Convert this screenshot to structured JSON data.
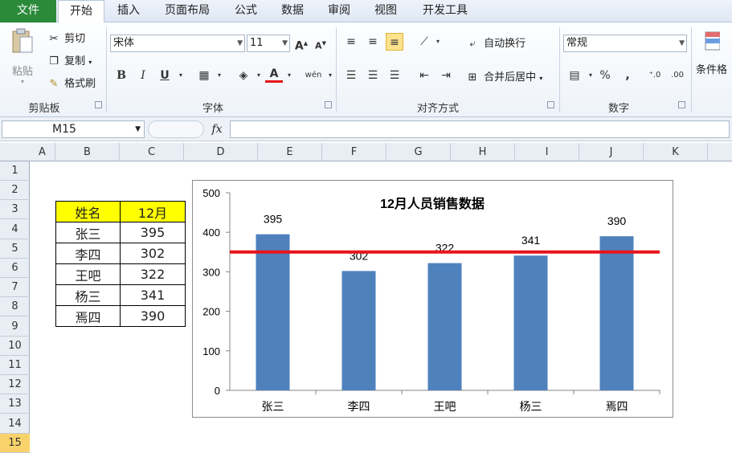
{
  "tabs": {
    "file": "文件",
    "home": "开始",
    "insert": "插入",
    "page_layout": "页面布局",
    "formulas": "公式",
    "data": "数据",
    "review": "审阅",
    "view": "视图",
    "developer": "开发工具"
  },
  "clipboard": {
    "paste": "粘贴",
    "cut": "剪切",
    "copy": "复制",
    "format_painter": "格式刷",
    "label": "剪贴板"
  },
  "font": {
    "name": "宋体",
    "size": "11",
    "label": "字体",
    "grow": "A",
    "shrink": "A",
    "bold": "B",
    "italic": "I",
    "underline": "U",
    "phonetic": "wén"
  },
  "alignment": {
    "wrap_text": "自动换行",
    "merge_center": "合并后居中",
    "label": "对齐方式"
  },
  "number": {
    "format": "常规",
    "label": "数字",
    "percent": "%",
    "comma": ","
  },
  "styles": {
    "conditional": "条件格"
  },
  "formula_bar": {
    "name_box": "M15",
    "fx": "fx",
    "content": ""
  },
  "columns": [
    "A",
    "B",
    "C",
    "D",
    "E",
    "F",
    "G",
    "H",
    "I",
    "J",
    "K"
  ],
  "rows": [
    "1",
    "2",
    "3",
    "4",
    "5",
    "6",
    "7",
    "8",
    "9",
    "10",
    "11",
    "12",
    "13",
    "14",
    "15"
  ],
  "table": {
    "header": [
      "姓名",
      "12月"
    ],
    "rows": [
      {
        "name": "张三",
        "value": "395"
      },
      {
        "name": "李四",
        "value": "302"
      },
      {
        "name": "王吧",
        "value": "322"
      },
      {
        "name": "杨三",
        "value": "341"
      },
      {
        "name": "焉四",
        "value": "390"
      }
    ]
  },
  "colors": {
    "bar": "#4f81bd",
    "average_line": "#e8141c",
    "header_fill": "#ffff00",
    "file_tab": "#2a8a3a"
  },
  "chart_data": {
    "type": "bar",
    "title": "12月人员销售数据",
    "categories": [
      "张三",
      "李四",
      "王吧",
      "杨三",
      "焉四"
    ],
    "values": [
      395,
      302,
      322,
      341,
      390
    ],
    "yticks": [
      "0",
      "100",
      "200",
      "300",
      "400",
      "500"
    ],
    "ylim": [
      0,
      500
    ],
    "reference_line": 350,
    "legend": "none",
    "grid": false,
    "data_labels": true
  }
}
